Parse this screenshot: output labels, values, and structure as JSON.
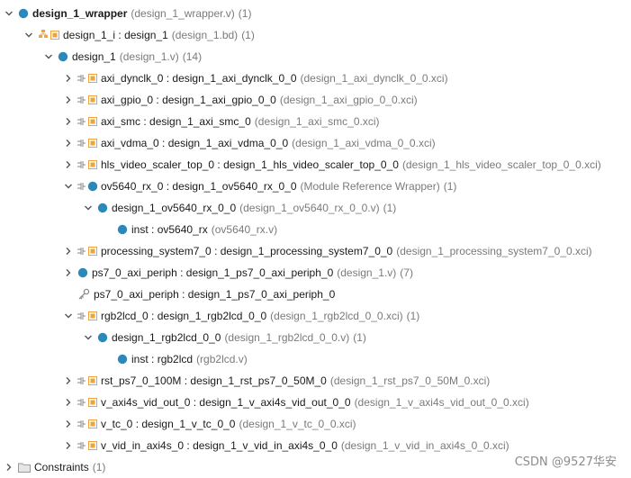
{
  "tree": [
    {
      "level": 0,
      "expanded": true,
      "icon": "circle-icon",
      "name": "design_1_wrapper",
      "bold": true,
      "module": "",
      "src": "(design_1_wrapper.v)",
      "count": "(1)"
    },
    {
      "level": 1,
      "expanded": true,
      "icon": "bd-hierarchy-icon",
      "name": "design_1_i",
      "bold": false,
      "module": "design_1",
      "src": "(design_1.bd)",
      "count": "(1)"
    },
    {
      "level": 2,
      "expanded": true,
      "icon": "circle-icon",
      "name": "design_1",
      "bold": false,
      "module": "",
      "src": "(design_1.v)",
      "count": "(14)"
    },
    {
      "level": 3,
      "expanded": false,
      "icon": "ip-block-icon",
      "name": "axi_dynclk_0",
      "bold": false,
      "module": "design_1_axi_dynclk_0_0",
      "src": "(design_1_axi_dynclk_0_0.xci)",
      "count": ""
    },
    {
      "level": 3,
      "expanded": false,
      "icon": "ip-block-icon",
      "name": "axi_gpio_0",
      "bold": false,
      "module": "design_1_axi_gpio_0_0",
      "src": "(design_1_axi_gpio_0_0.xci)",
      "count": ""
    },
    {
      "level": 3,
      "expanded": false,
      "icon": "ip-block-icon",
      "name": "axi_smc",
      "bold": false,
      "module": "design_1_axi_smc_0",
      "src": "(design_1_axi_smc_0.xci)",
      "count": ""
    },
    {
      "level": 3,
      "expanded": false,
      "icon": "ip-block-icon",
      "name": "axi_vdma_0",
      "bold": false,
      "module": "design_1_axi_vdma_0_0",
      "src": "(design_1_axi_vdma_0_0.xci)",
      "count": ""
    },
    {
      "level": 3,
      "expanded": false,
      "icon": "ip-block-icon",
      "name": "hls_video_scaler_top_0",
      "bold": false,
      "module": "design_1_hls_video_scaler_top_0_0",
      "src": "(design_1_hls_video_scaler_top_0_0.xci)",
      "count": ""
    },
    {
      "level": 3,
      "expanded": true,
      "icon": "module-ref-icon",
      "name": "ov5640_rx_0",
      "bold": false,
      "module": "design_1_ov5640_rx_0_0",
      "src": "(Module Reference Wrapper)",
      "count": "(1)"
    },
    {
      "level": 4,
      "expanded": true,
      "icon": "circle-icon",
      "name": "design_1_ov5640_rx_0_0",
      "bold": false,
      "module": "",
      "src": "(design_1_ov5640_rx_0_0.v)",
      "count": "(1)"
    },
    {
      "level": 5,
      "expanded": null,
      "icon": "circle-icon",
      "name": "inst",
      "bold": false,
      "module": "ov5640_rx",
      "src": "(ov5640_rx.v)",
      "count": ""
    },
    {
      "level": 3,
      "expanded": false,
      "icon": "ip-block-icon",
      "name": "processing_system7_0",
      "bold": false,
      "module": "design_1_processing_system7_0_0",
      "src": "(design_1_processing_system7_0_0.xci)",
      "count": ""
    },
    {
      "level": 3,
      "expanded": false,
      "icon": "circle-icon",
      "name": "ps7_0_axi_periph",
      "bold": false,
      "module": "design_1_ps7_0_axi_periph_0",
      "src": "(design_1.v)",
      "count": "(7)"
    },
    {
      "level": 3,
      "expanded": null,
      "icon": "key-icon",
      "name": "ps7_0_axi_periph",
      "bold": false,
      "module": "design_1_ps7_0_axi_periph_0",
      "src": "",
      "count": ""
    },
    {
      "level": 3,
      "expanded": true,
      "icon": "ip-block-icon",
      "name": "rgb2lcd_0",
      "bold": false,
      "module": "design_1_rgb2lcd_0_0",
      "src": "(design_1_rgb2lcd_0_0.xci)",
      "count": "(1)"
    },
    {
      "level": 4,
      "expanded": true,
      "icon": "circle-icon",
      "name": "design_1_rgb2lcd_0_0",
      "bold": false,
      "module": "",
      "src": "(design_1_rgb2lcd_0_0.v)",
      "count": "(1)"
    },
    {
      "level": 5,
      "expanded": null,
      "icon": "circle-icon",
      "name": "inst",
      "bold": false,
      "module": "rgb2lcd",
      "src": "(rgb2lcd.v)",
      "count": ""
    },
    {
      "level": 3,
      "expanded": false,
      "icon": "ip-block-icon",
      "name": "rst_ps7_0_100M",
      "bold": false,
      "module": "design_1_rst_ps7_0_50M_0",
      "src": "(design_1_rst_ps7_0_50M_0.xci)",
      "count": ""
    },
    {
      "level": 3,
      "expanded": false,
      "icon": "ip-block-icon",
      "name": "v_axi4s_vid_out_0",
      "bold": false,
      "module": "design_1_v_axi4s_vid_out_0_0",
      "src": "(design_1_v_axi4s_vid_out_0_0.xci)",
      "count": ""
    },
    {
      "level": 3,
      "expanded": false,
      "icon": "ip-block-icon",
      "name": "v_tc_0",
      "bold": false,
      "module": "design_1_v_tc_0_0",
      "src": "(design_1_v_tc_0_0.xci)",
      "count": ""
    },
    {
      "level": 3,
      "expanded": false,
      "icon": "ip-block-icon",
      "name": "v_vid_in_axi4s_0",
      "bold": false,
      "module": "design_1_v_vid_in_axi4s_0_0",
      "src": "(design_1_v_vid_in_axi4s_0_0.xci)",
      "count": ""
    },
    {
      "level": 0,
      "expanded": false,
      "icon": "folder-icon",
      "name": "Constraints",
      "bold": false,
      "module": "",
      "src": "",
      "count": "(1)"
    }
  ],
  "watermark": "CSDN @9527华安",
  "colors": {
    "circle": "#2b89ba",
    "chevron": "#555555",
    "ip_orange": "#f0a23b",
    "pin_gray": "#8a8a8a",
    "muted_text": "#7a7a7a"
  }
}
